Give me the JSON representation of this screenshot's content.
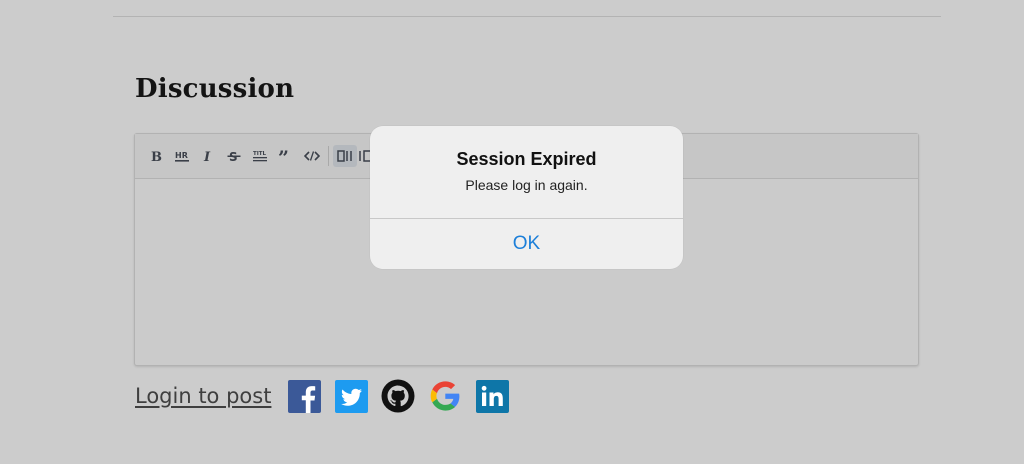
{
  "section": {
    "title": "Discussion"
  },
  "editor": {
    "toolbar": [
      {
        "name": "bold",
        "icon": "bold-icon"
      },
      {
        "name": "horizontal-rule",
        "icon": "hr-icon"
      },
      {
        "name": "italic",
        "icon": "italic-icon"
      },
      {
        "name": "strikethrough",
        "icon": "strikethrough-icon"
      },
      {
        "name": "title",
        "icon": "title-icon"
      },
      {
        "name": "quote",
        "icon": "quote-icon"
      },
      {
        "name": "code",
        "icon": "code-icon"
      },
      {
        "name": "toggle-preview",
        "icon": "side-by-side-icon"
      },
      {
        "name": "fullscreen-preview",
        "icon": "preview-icon"
      }
    ],
    "content": ""
  },
  "login": {
    "label": "Login to post",
    "providers": [
      {
        "name": "Facebook",
        "icon": "facebook-icon",
        "color": "#3b5998"
      },
      {
        "name": "Twitter",
        "icon": "twitter-icon",
        "color": "#1da1f2"
      },
      {
        "name": "GitHub",
        "icon": "github-icon",
        "color": "#111111"
      },
      {
        "name": "Google",
        "icon": "google-icon",
        "color": "#4285f4"
      },
      {
        "name": "LinkedIn",
        "icon": "linkedin-icon",
        "color": "#0e76a8"
      }
    ]
  },
  "dialog": {
    "title": "Session Expired",
    "message": "Please log in again.",
    "ok_label": "OK"
  },
  "colors": {
    "overlay": "#cccccc",
    "dialog_background": "#efefef",
    "ok_accent": "#1c7fd9"
  }
}
